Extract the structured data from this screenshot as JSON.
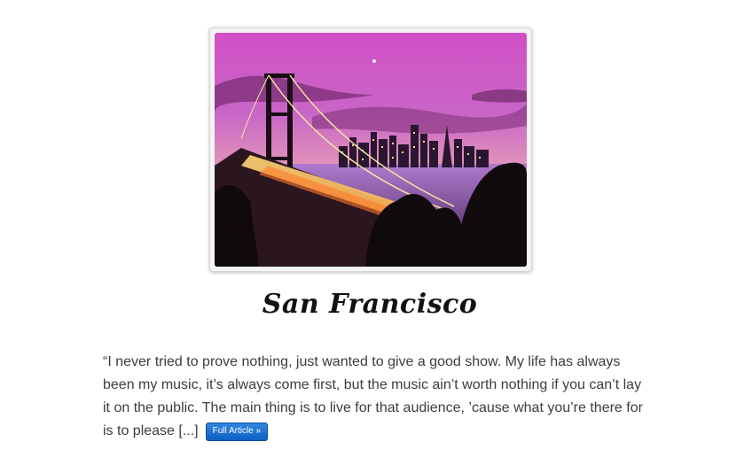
{
  "post": {
    "image_subject": "Bay Bridge and San Francisco skyline at dusk",
    "title": "San Francisco",
    "excerpt": "“I never tried to prove nothing, just wanted to give a good show. My life has always been my music, it’s always come first, but the music ain’t worth nothing if you can’t lay it on the public. The main thing is to live for that audience, ’cause what you’re there for is to please [...]",
    "read_more_label": "Full Article »"
  }
}
